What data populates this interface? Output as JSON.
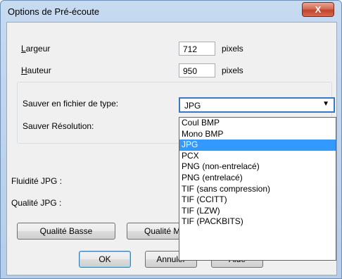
{
  "window": {
    "title": "Options de Pré-écoute",
    "close_glyph": "X"
  },
  "width": {
    "label_u": "L",
    "label_rest": "argeur",
    "value": "712",
    "unit": "pixels"
  },
  "height": {
    "label_u": "H",
    "label_rest": "auteur",
    "value": "950",
    "unit": "pixels"
  },
  "filetype": {
    "label": "Sauver en fichier de type:",
    "selected": "JPG",
    "arrow": "▼"
  },
  "resolution": {
    "label": "Sauver Résolution:"
  },
  "jpg": {
    "fluidity_label": "Fluidité JPG :",
    "quality_label": "Qualité JPG :"
  },
  "quality_buttons": {
    "low": "Qualité Basse",
    "medium_visible": "Qualité M"
  },
  "dropdown_options": [
    "Coul BMP",
    "Mono BMP",
    "JPG",
    "PCX",
    "PNG (non-entrelacé)",
    "PNG (entrelacé)",
    "TIF (sans compression)",
    "TIF (CCITT)",
    "TIF (LZW)",
    "TIF (PACKBITS)"
  ],
  "dropdown_selected_index": 2,
  "buttons": {
    "ok": "OK",
    "cancel": "Annuler",
    "help": "Aide"
  },
  "colors": {
    "selection": "#3399ff",
    "title_gradient": "#c6daf0",
    "close_red": "#c0432b"
  }
}
